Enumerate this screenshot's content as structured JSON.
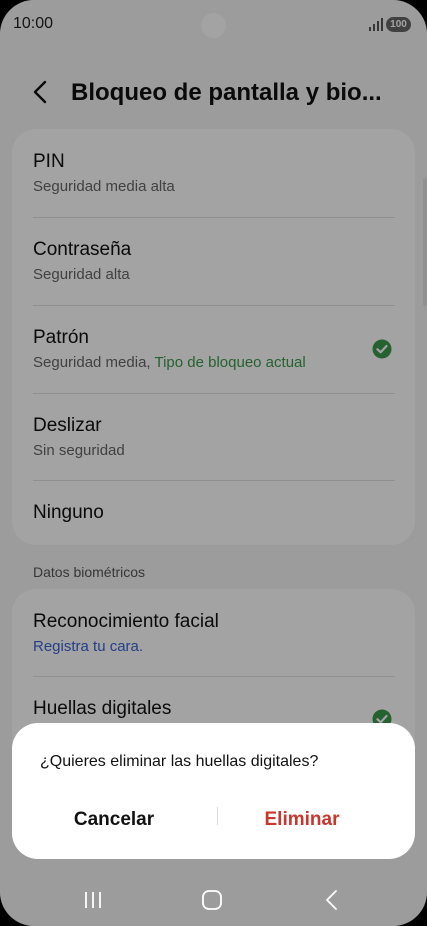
{
  "status_bar": {
    "time": "10:00",
    "battery": "100"
  },
  "header": {
    "title": "Bloqueo de pantalla y bio..."
  },
  "lock_options": [
    {
      "title": "PIN",
      "subtitle": "Seguridad media alta"
    },
    {
      "title": "Contraseña",
      "subtitle": "Seguridad alta"
    },
    {
      "title": "Patrón",
      "subtitle": "Seguridad media,",
      "current_label": "Tipo de bloqueo actual",
      "selected": true
    },
    {
      "title": "Deslizar",
      "subtitle": "Sin seguridad"
    },
    {
      "title": "Ninguno"
    }
  ],
  "biometrics": {
    "section_label": "Datos biométricos",
    "items": [
      {
        "title": "Reconocimiento facial",
        "subtitle": "Registra tu cara."
      },
      {
        "title": "Huellas digitales",
        "selected": true
      }
    ]
  },
  "dialog": {
    "message": "¿Quieres eliminar las huellas digitales?",
    "cancel_label": "Cancelar",
    "delete_label": "Eliminar"
  },
  "colors": {
    "accent_green": "#3a9a4c",
    "link_blue": "#3a63d4",
    "destructive_red": "#c8362e"
  },
  "icons": [
    "back-icon",
    "check-icon",
    "recents-icon",
    "home-icon",
    "nav-back-icon",
    "signal-icon",
    "battery-icon"
  ]
}
